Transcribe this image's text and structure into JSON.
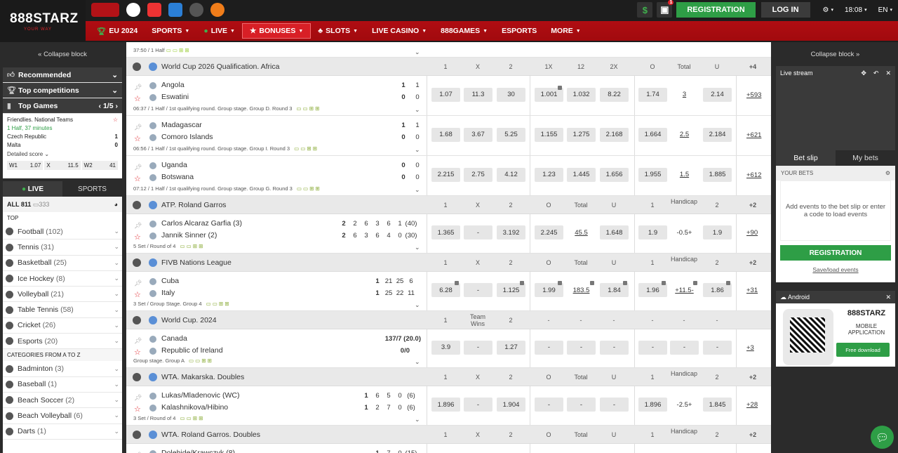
{
  "header": {
    "logo_text": "888STARZ",
    "logo_tagline": "YOUR WAY",
    "register_label": "REGISTRATION",
    "login_label": "LOG IN",
    "time": "18:08",
    "lang": "EN",
    "currency_symbol": "$",
    "gift_badge": "1"
  },
  "nav": {
    "items": [
      {
        "label": "EU 2024"
      },
      {
        "label": "SPORTS"
      },
      {
        "label": "LIVE"
      },
      {
        "label": "BONUSES"
      },
      {
        "label": "SLOTS"
      },
      {
        "label": "LIVE CASINO"
      },
      {
        "label": "888GAMES"
      },
      {
        "label": "ESPORTS"
      },
      {
        "label": "MORE"
      }
    ]
  },
  "left": {
    "collapse_label": "Collapse block",
    "recommended": "Recommended",
    "top_competitions": "Top competitions",
    "top_games": "Top Games",
    "pager": "1/5",
    "game_league": "Friendlies. National Teams",
    "game_status": "1 Half, 37 minutes",
    "game_team1": "Czech Republic",
    "game_team2": "Malta",
    "game_score1": "1",
    "game_score2": "0",
    "detailed_score": "Detailed score",
    "w1_label": "W1",
    "w1_val": "1.07",
    "x_label": "X",
    "x_val": "11.5",
    "w2_label": "W2",
    "w2_val": "41",
    "tab_live": "LIVE",
    "tab_sports": "SPORTS",
    "all_label": "ALL 811",
    "all_count": "333",
    "top_label": "TOP",
    "categories_label": "CATEGORIES FROM A TO Z",
    "sports_top": [
      {
        "name": "Football",
        "count": "(102)"
      },
      {
        "name": "Tennis",
        "count": "(31)"
      },
      {
        "name": "Basketball",
        "count": "(25)"
      },
      {
        "name": "Ice Hockey",
        "count": "(8)"
      },
      {
        "name": "Volleyball",
        "count": "(21)"
      },
      {
        "name": "Table Tennis",
        "count": "(58)"
      },
      {
        "name": "Cricket",
        "count": "(26)"
      },
      {
        "name": "Esports",
        "count": "(20)"
      }
    ],
    "sports_az": [
      {
        "name": "Badminton",
        "count": "(3)"
      },
      {
        "name": "Baseball",
        "count": "(1)"
      },
      {
        "name": "Beach Soccer",
        "count": "(2)"
      },
      {
        "name": "Beach Volleyball",
        "count": "(6)"
      },
      {
        "name": "Darts",
        "count": "(1)"
      }
    ]
  },
  "main": {
    "top_partial_info": "37:50 / 1 Half",
    "sections": [
      {
        "title": "World Cup 2026 Qualification. Africa",
        "headers": [
          "1",
          "X",
          "2",
          "1X",
          "12",
          "2X",
          "O",
          "Total",
          "U",
          "+4"
        ],
        "matches": [
          {
            "team1": "Angola",
            "team2": "Eswatini",
            "s1": [
              "1",
              "1"
            ],
            "s2": [
              "0",
              "0"
            ],
            "info": "06:37 / 1 Half / 1st qualifying round. Group stage. Group D. Round 3",
            "odds": [
              "1.07",
              "11.3",
              "30",
              "1.001",
              "1.032",
              "8.22",
              "1.74",
              "3",
              "2.14"
            ],
            "more": "+593"
          },
          {
            "team1": "Madagascar",
            "team2": "Comoro Islands",
            "s1": [
              "1",
              "1"
            ],
            "s2": [
              "0",
              "0"
            ],
            "info": "06:56 / 1 Half / 1st qualifying round. Group stage. Group I. Round 3",
            "odds": [
              "1.68",
              "3.67",
              "5.25",
              "1.155",
              "1.275",
              "2.168",
              "1.664",
              "2.5",
              "2.184"
            ],
            "more": "+621"
          },
          {
            "team1": "Uganda",
            "team2": "Botswana",
            "s1": [
              "0",
              "0"
            ],
            "s2": [
              "0",
              "0"
            ],
            "info": "07:12 / 1 Half / 1st qualifying round. Group stage. Group G. Round 3",
            "odds": [
              "2.215",
              "2.75",
              "4.12",
              "1.23",
              "1.445",
              "1.656",
              "1.955",
              "1.5",
              "1.885"
            ],
            "more": "+612"
          }
        ]
      },
      {
        "title": "ATP. Roland Garros",
        "headers": [
          "1",
          "X",
          "2",
          "O",
          "Total",
          "U",
          "1",
          "Handicap",
          "2",
          "+2"
        ],
        "matches": [
          {
            "team1": "Carlos Alcaraz Garfia (3)",
            "team2": "Jannik Sinner (2)",
            "set1": "2",
            "set2": "2",
            "g1": [
              "2",
              "6",
              "3",
              "6",
              "1",
              "(40)"
            ],
            "g2": [
              "6",
              "3",
              "6",
              "4",
              "0",
              "(30)"
            ],
            "info": "5 Set / Round of 4",
            "odds": [
              "1.365",
              "-",
              "3.192",
              "2.245",
              "45.5",
              "1.648",
              "1.9",
              "-0.5+",
              "1.9"
            ],
            "more": "+90"
          }
        ]
      },
      {
        "title": "FIVB Nations League",
        "headers": [
          "1",
          "X",
          "2",
          "O",
          "Total",
          "U",
          "1",
          "Handicap",
          "2",
          "+2"
        ],
        "matches": [
          {
            "team1": "Cuba",
            "team2": "Italy",
            "set1": "1",
            "set2": "1",
            "g1": [
              "21",
              "25",
              "6"
            ],
            "g2": [
              "25",
              "22",
              "11"
            ],
            "info": "3 Set / Group Stage. Group 4",
            "odds": [
              "6.28",
              "-",
              "1.125",
              "1.99",
              "183.5",
              "1.84",
              "1.96",
              "+11.5-",
              "1.86"
            ],
            "more": "+31"
          }
        ]
      },
      {
        "title": "World Cup. 2024",
        "headers": [
          "1",
          "Team Wins",
          "2",
          "-",
          "-",
          "-",
          "-",
          "-",
          "-",
          ""
        ],
        "matches": [
          {
            "team1": "Canada",
            "team2": "Republic of Ireland",
            "sc1": "137/7 (20.0)",
            "sc2": "0/0",
            "info": "Group stage. Group A",
            "odds": [
              "3.9",
              "-",
              "1.27",
              "-",
              "-",
              "-",
              "-",
              "-",
              "-"
            ],
            "more": "+3"
          }
        ]
      },
      {
        "title": "WTA. Makarska. Doubles",
        "headers": [
          "1",
          "X",
          "2",
          "O",
          "Total",
          "U",
          "1",
          "Handicap",
          "2",
          "+2"
        ],
        "matches": [
          {
            "team1": "Lukas/Mladenovic (WC)",
            "team2": "Kalashnikova/Hibino",
            "set1": "1",
            "set2": "1",
            "g1": [
              "6",
              "5",
              "0",
              "(6)"
            ],
            "g2": [
              "2",
              "7",
              "0",
              "(6)"
            ],
            "info": "3 Set / Round of 4",
            "odds": [
              "1.896",
              "-",
              "1.904",
              "-",
              "-",
              "-",
              "1.896",
              "-2.5+",
              "1.845"
            ],
            "more": "+28"
          }
        ]
      },
      {
        "title": "WTA. Roland Garros. Doubles",
        "headers": [
          "1",
          "X",
          "2",
          "O",
          "Total",
          "U",
          "1",
          "Handicap",
          "2",
          "+2"
        ],
        "matches": [
          {
            "team1": "Dolehide/Krawczyk (8)",
            "set1": "1",
            "g1": [
              "7",
              "0",
              "(15)"
            ]
          }
        ]
      }
    ]
  },
  "right": {
    "collapse_label": "Collapse block",
    "live_stream": "Live stream",
    "tab_betslip": "Bet slip",
    "tab_mybets": "My bets",
    "your_bets": "YOUR BETS",
    "empty_text": "Add events to the bet slip or enter a code to load events",
    "register_label": "REGISTRATION",
    "save_load": "Save/load events",
    "android_label": "Android",
    "app_logo": "888STARZ",
    "app_caption": "MOBILE APPLICATION",
    "free_download": "Free download"
  }
}
